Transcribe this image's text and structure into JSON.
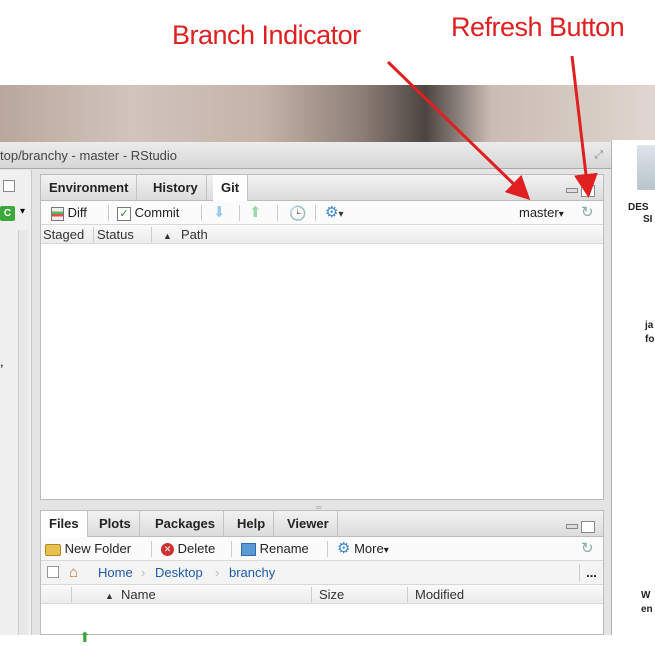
{
  "annotations": {
    "branch_indicator": "Branch Indicator",
    "refresh_button": "Refresh Button"
  },
  "window": {
    "title": "top/branchy - master - RStudio"
  },
  "desktop": {
    "labels": [
      "DES",
      "SI",
      "ja",
      "fo",
      "W",
      "en"
    ]
  },
  "git_pane": {
    "tabs": [
      {
        "label": "Environment",
        "active": false
      },
      {
        "label": "History",
        "active": false
      },
      {
        "label": "Git",
        "active": true
      }
    ],
    "toolbar": {
      "diff": "Diff",
      "commit": "Commit",
      "branch": "master"
    },
    "columns": [
      "Staged",
      "Status",
      "Path"
    ],
    "rows": []
  },
  "files_pane": {
    "tabs": [
      {
        "label": "Files",
        "active": true
      },
      {
        "label": "Plots",
        "active": false
      },
      {
        "label": "Packages",
        "active": false
      },
      {
        "label": "Help",
        "active": false
      },
      {
        "label": "Viewer",
        "active": false
      }
    ],
    "toolbar": {
      "new_folder": "New Folder",
      "delete": "Delete",
      "rename": "Rename",
      "more": "More"
    },
    "breadcrumb": [
      "Home",
      "Desktop",
      "branchy"
    ],
    "columns": [
      "Name",
      "Size",
      "Modified"
    ],
    "ellipsis": "..."
  },
  "left_strip": {
    "c_badge": "C"
  }
}
